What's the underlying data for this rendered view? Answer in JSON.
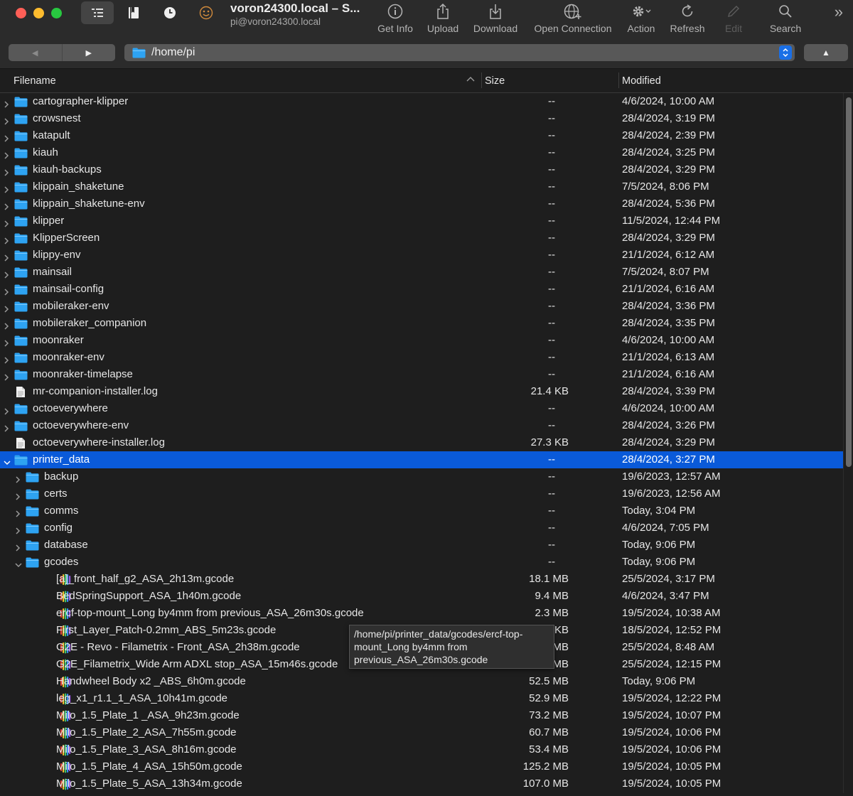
{
  "window": {
    "title": "voron24300.local – S...",
    "subtitle": "pi@voron24300.local"
  },
  "toolbar": {
    "tools": [
      {
        "label": "Get Info",
        "icon": "info-icon",
        "enabled": true
      },
      {
        "label": "Upload",
        "icon": "upload-icon",
        "enabled": true
      },
      {
        "label": "Download",
        "icon": "download-icon",
        "enabled": true
      },
      {
        "label": "Open Connection",
        "icon": "globe-plus-icon",
        "enabled": true
      },
      {
        "label": "Action",
        "icon": "gear-icon",
        "enabled": true
      },
      {
        "label": "Refresh",
        "icon": "refresh-icon",
        "enabled": true
      },
      {
        "label": "Edit",
        "icon": "pencil-icon",
        "enabled": false
      },
      {
        "label": "Search",
        "icon": "search-icon",
        "enabled": true
      }
    ]
  },
  "pathbar": {
    "path": "/home/pi"
  },
  "columns": {
    "filename": "Filename",
    "size": "Size",
    "modified": "Modified"
  },
  "files": [
    {
      "name": "cartographer-klipper",
      "size": "--",
      "modified": "4/6/2024, 10:00 AM",
      "kind": "folder",
      "depth": 0,
      "expanded": false
    },
    {
      "name": "crowsnest",
      "size": "--",
      "modified": "28/4/2024, 3:19 PM",
      "kind": "folder",
      "depth": 0,
      "expanded": false
    },
    {
      "name": "katapult",
      "size": "--",
      "modified": "28/4/2024, 2:39 PM",
      "kind": "folder",
      "depth": 0,
      "expanded": false
    },
    {
      "name": "kiauh",
      "size": "--",
      "modified": "28/4/2024, 3:25 PM",
      "kind": "folder",
      "depth": 0,
      "expanded": false
    },
    {
      "name": "kiauh-backups",
      "size": "--",
      "modified": "28/4/2024, 3:29 PM",
      "kind": "folder",
      "depth": 0,
      "expanded": false
    },
    {
      "name": "klippain_shaketune",
      "size": "--",
      "modified": "7/5/2024, 8:06 PM",
      "kind": "folder",
      "depth": 0,
      "expanded": false
    },
    {
      "name": "klippain_shaketune-env",
      "size": "--",
      "modified": "28/4/2024, 5:36 PM",
      "kind": "folder",
      "depth": 0,
      "expanded": false
    },
    {
      "name": "klipper",
      "size": "--",
      "modified": "11/5/2024, 12:44 PM",
      "kind": "folder",
      "depth": 0,
      "expanded": false
    },
    {
      "name": "KlipperScreen",
      "size": "--",
      "modified": "28/4/2024, 3:29 PM",
      "kind": "folder",
      "depth": 0,
      "expanded": false
    },
    {
      "name": "klippy-env",
      "size": "--",
      "modified": "21/1/2024, 6:12 AM",
      "kind": "folder",
      "depth": 0,
      "expanded": false
    },
    {
      "name": "mainsail",
      "size": "--",
      "modified": "7/5/2024, 8:07 PM",
      "kind": "folder",
      "depth": 0,
      "expanded": false
    },
    {
      "name": "mainsail-config",
      "size": "--",
      "modified": "21/1/2024, 6:16 AM",
      "kind": "folder",
      "depth": 0,
      "expanded": false
    },
    {
      "name": "mobileraker-env",
      "size": "--",
      "modified": "28/4/2024, 3:36 PM",
      "kind": "folder",
      "depth": 0,
      "expanded": false
    },
    {
      "name": "mobileraker_companion",
      "size": "--",
      "modified": "28/4/2024, 3:35 PM",
      "kind": "folder",
      "depth": 0,
      "expanded": false
    },
    {
      "name": "moonraker",
      "size": "--",
      "modified": "4/6/2024, 10:00 AM",
      "kind": "folder",
      "depth": 0,
      "expanded": false
    },
    {
      "name": "moonraker-env",
      "size": "--",
      "modified": "21/1/2024, 6:13 AM",
      "kind": "folder",
      "depth": 0,
      "expanded": false
    },
    {
      "name": "moonraker-timelapse",
      "size": "--",
      "modified": "21/1/2024, 6:16 AM",
      "kind": "folder",
      "depth": 0,
      "expanded": false
    },
    {
      "name": "mr-companion-installer.log",
      "size": "21.4 KB",
      "modified": "28/4/2024, 3:39 PM",
      "kind": "doc",
      "depth": 0
    },
    {
      "name": "octoeverywhere",
      "size": "--",
      "modified": "4/6/2024, 10:00 AM",
      "kind": "folder",
      "depth": 0,
      "expanded": false
    },
    {
      "name": "octoeverywhere-env",
      "size": "--",
      "modified": "28/4/2024, 3:26 PM",
      "kind": "folder",
      "depth": 0,
      "expanded": false
    },
    {
      "name": "octoeverywhere-installer.log",
      "size": "27.3 KB",
      "modified": "28/4/2024, 3:29 PM",
      "kind": "doc",
      "depth": 0
    },
    {
      "name": "printer_data",
      "size": "--",
      "modified": "28/4/2024, 3:27 PM",
      "kind": "folder",
      "depth": 0,
      "expanded": true,
      "selected": true
    },
    {
      "name": "backup",
      "size": "--",
      "modified": "19/6/2023, 12:57 AM",
      "kind": "folder",
      "depth": 1,
      "expanded": false
    },
    {
      "name": "certs",
      "size": "--",
      "modified": "19/6/2023, 12:56 AM",
      "kind": "folder",
      "depth": 1,
      "expanded": false
    },
    {
      "name": "comms",
      "size": "--",
      "modified": "Today, 3:04 PM",
      "kind": "folder",
      "depth": 1,
      "expanded": false
    },
    {
      "name": "config",
      "size": "--",
      "modified": "4/6/2024, 7:05 PM",
      "kind": "folder",
      "depth": 1,
      "expanded": false
    },
    {
      "name": "database",
      "size": "--",
      "modified": "Today, 9:06 PM",
      "kind": "folder",
      "depth": 1,
      "expanded": false
    },
    {
      "name": "gcodes",
      "size": "--",
      "modified": "Today, 9:06 PM",
      "kind": "folder",
      "depth": 1,
      "expanded": true
    },
    {
      "name": "[a]_front_half_g2_ASA_2h13m.gcode",
      "size": "18.1 MB",
      "modified": "25/5/2024, 3:17 PM",
      "kind": "gcode",
      "depth": 2
    },
    {
      "name": "BedSpringSupport_ASA_1h40m.gcode",
      "size": "9.4 MB",
      "modified": "4/6/2024, 3:47 PM",
      "kind": "gcode",
      "depth": 2
    },
    {
      "name": "ercf-top-mount_Long by4mm from previous_ASA_26m30s.gcode",
      "size": "2.3 MB",
      "modified": "19/5/2024, 10:38 AM",
      "kind": "gcode",
      "depth": 2
    },
    {
      "name": "First_Layer_Patch-0.2mm_ABS_5m23s.gcode",
      "size": ".1 KB",
      "modified": "18/5/2024, 12:52 PM",
      "kind": "gcode",
      "depth": 2
    },
    {
      "name": "G2E - Revo - Filametrix -  Front_ASA_2h38m.gcode",
      "size": "2 MB",
      "modified": "25/5/2024, 8:48 AM",
      "kind": "gcode",
      "depth": 2
    },
    {
      "name": "G2E_Filametrix_Wide Arm ADXL stop_ASA_15m46s.gcode",
      "size": "l MB",
      "modified": "25/5/2024, 12:15 PM",
      "kind": "gcode",
      "depth": 2
    },
    {
      "name": "Handwheel Body x2 _ABS_6h0m.gcode",
      "size": "52.5 MB",
      "modified": "Today, 9:06 PM",
      "kind": "gcode",
      "depth": 2
    },
    {
      "name": "leg_x1_r1.1_1_ASA_10h41m.gcode",
      "size": "52.9 MB",
      "modified": "19/5/2024, 12:22 PM",
      "kind": "gcode",
      "depth": 2
    },
    {
      "name": "Milo_1.5_Plate_1 _ASA_9h23m.gcode",
      "size": "73.2 MB",
      "modified": "19/5/2024, 10:07 PM",
      "kind": "gcode",
      "depth": 2
    },
    {
      "name": "Milo_1.5_Plate_2_ASA_7h55m.gcode",
      "size": "60.7 MB",
      "modified": "19/5/2024, 10:06 PM",
      "kind": "gcode",
      "depth": 2
    },
    {
      "name": "Milo_1.5_Plate_3_ASA_8h16m.gcode",
      "size": "53.4 MB",
      "modified": "19/5/2024, 10:06 PM",
      "kind": "gcode",
      "depth": 2
    },
    {
      "name": "Milo_1.5_Plate_4_ASA_15h50m.gcode",
      "size": "125.2 MB",
      "modified": "19/5/2024, 10:05 PM",
      "kind": "gcode",
      "depth": 2
    },
    {
      "name": "Milo_1.5_Plate_5_ASA_13h34m.gcode",
      "size": "107.0 MB",
      "modified": "19/5/2024, 10:05 PM",
      "kind": "gcode",
      "depth": 2
    }
  ],
  "tooltip": {
    "lines": [
      "/home/pi/printer_data/gcodes/ercf-top-",
      "mount_Long by4mm from",
      "previous_ASA_26m30s.gcode"
    ]
  },
  "colors": {
    "accent": "#0a5ad9",
    "folder": "#2ea3f2",
    "background": "#1e1e1e"
  }
}
